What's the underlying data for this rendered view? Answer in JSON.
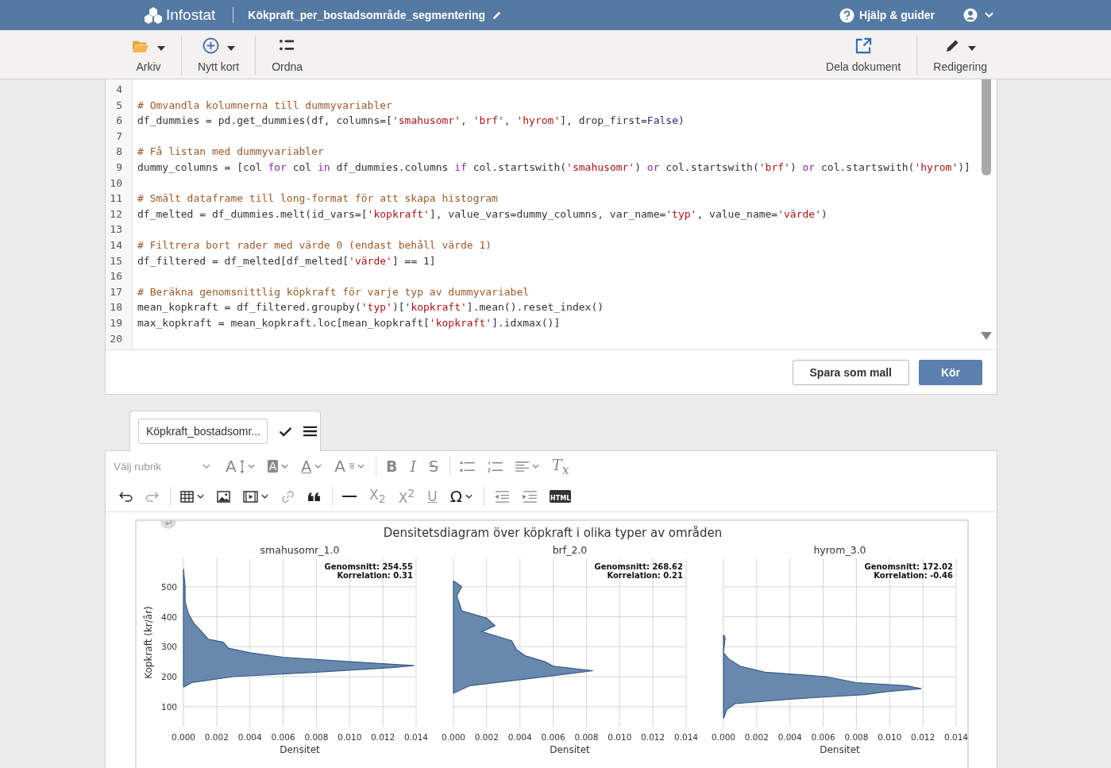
{
  "header": {
    "app_name": "Infostat",
    "document_title": "Kökpraft_per_bostadsområde_segmentering",
    "help": "Hjälp & guider"
  },
  "toolbar": {
    "left": [
      {
        "label": "Arkiv",
        "dropdown": true
      },
      {
        "label": "Nytt kort",
        "dropdown": true
      },
      {
        "label": "Ordna",
        "dropdown": false
      }
    ],
    "right": [
      {
        "label": "Dela dokument",
        "dropdown": false
      },
      {
        "label": "Redigering",
        "dropdown": true
      }
    ]
  },
  "code_editor": {
    "lines": [
      {
        "num": "4"
      },
      {
        "num": "5",
        "tokens": [
          {
            "kind": "comment",
            "text": "# Omvandla kolumnerna till dummyvariabler"
          }
        ]
      },
      {
        "num": "6",
        "tokens": [
          {
            "kind": "plain",
            "text": "df_dummies = pd.get_dummies(df, columns=["
          },
          {
            "kind": "string",
            "text": "'smahusomr'"
          },
          {
            "kind": "plain",
            "text": ", "
          },
          {
            "kind": "string",
            "text": "'brf'"
          },
          {
            "kind": "plain",
            "text": ", "
          },
          {
            "kind": "string",
            "text": "'hyrom'"
          },
          {
            "kind": "plain",
            "text": "], drop_first="
          },
          {
            "kind": "constant",
            "text": "False"
          },
          {
            "kind": "plain",
            "text": ")"
          }
        ]
      },
      {
        "num": "7"
      },
      {
        "num": "8",
        "tokens": [
          {
            "kind": "comment",
            "text": "# Få listan med dummyvariabler"
          }
        ]
      },
      {
        "num": "9",
        "tokens": [
          {
            "kind": "plain",
            "text": "dummy_columns = [col "
          },
          {
            "kind": "keyword",
            "text": "for"
          },
          {
            "kind": "plain",
            "text": " col "
          },
          {
            "kind": "keyword",
            "text": "in"
          },
          {
            "kind": "plain",
            "text": " df_dummies.columns "
          },
          {
            "kind": "keyword",
            "text": "if"
          },
          {
            "kind": "plain",
            "text": " col.startswith("
          },
          {
            "kind": "string",
            "text": "'smahusomr'"
          },
          {
            "kind": "plain",
            "text": ") "
          },
          {
            "kind": "keyword",
            "text": "or"
          },
          {
            "kind": "plain",
            "text": " col.startswith("
          },
          {
            "kind": "string",
            "text": "'brf'"
          },
          {
            "kind": "plain",
            "text": ") "
          },
          {
            "kind": "keyword",
            "text": "or"
          },
          {
            "kind": "plain",
            "text": " col.startswith("
          },
          {
            "kind": "string",
            "text": "'hyrom'"
          },
          {
            "kind": "plain",
            "text": ")]"
          }
        ]
      },
      {
        "num": "10"
      },
      {
        "num": "11",
        "tokens": [
          {
            "kind": "comment",
            "text": "# Smält dataframe till long-format för att skapa histogram"
          }
        ]
      },
      {
        "num": "12",
        "tokens": [
          {
            "kind": "plain",
            "text": "df_melted = df_dummies.melt(id_vars=["
          },
          {
            "kind": "string",
            "text": "'kopkraft'"
          },
          {
            "kind": "plain",
            "text": "], value_vars=dummy_columns, var_name="
          },
          {
            "kind": "string",
            "text": "'typ'"
          },
          {
            "kind": "plain",
            "text": ", value_name="
          },
          {
            "kind": "string",
            "text": "'värde'"
          },
          {
            "kind": "plain",
            "text": ")"
          }
        ]
      },
      {
        "num": "13"
      },
      {
        "num": "14",
        "tokens": [
          {
            "kind": "comment",
            "text": "# Filtrera bort rader med värde 0 (endast behåll värde 1)"
          }
        ]
      },
      {
        "num": "15",
        "tokens": [
          {
            "kind": "plain",
            "text": "df_filtered = df_melted[df_melted["
          },
          {
            "kind": "string",
            "text": "'värde'"
          },
          {
            "kind": "plain",
            "text": "] == 1]"
          }
        ]
      },
      {
        "num": "16"
      },
      {
        "num": "17",
        "tokens": [
          {
            "kind": "comment",
            "text": "# Beräkna genomsnittlig köpkraft för varje typ av dummyvariabel"
          }
        ]
      },
      {
        "num": "18",
        "tokens": [
          {
            "kind": "plain",
            "text": "mean_kopkraft = df_filtered.groupby("
          },
          {
            "kind": "string",
            "text": "'typ'"
          },
          {
            "kind": "plain",
            "text": ")["
          },
          {
            "kind": "string",
            "text": "'kopkraft'"
          },
          {
            "kind": "plain",
            "text": "].mean().reset_index()"
          }
        ]
      },
      {
        "num": "19",
        "tokens": [
          {
            "kind": "plain",
            "text": "max_kopkraft = mean_kopkraft.loc[mean_kopkraft["
          },
          {
            "kind": "string",
            "text": "'kopkraft'"
          },
          {
            "kind": "plain",
            "text": "].idxmax()]"
          }
        ]
      },
      {
        "num": "20"
      }
    ],
    "buttons": [
      {
        "label": "Spara som mall",
        "kind": "secondary"
      },
      {
        "label": "Kör",
        "kind": "primary"
      }
    ]
  },
  "card_tab": {
    "value": "Köpkraft_bostadsomr..."
  },
  "editor_toolbar": {
    "heading_placeholder": "Välj rubrik",
    "glyphs": {
      "font_size": "A",
      "highlight": "A",
      "font_color": "A",
      "line_height": "A",
      "bold": "B",
      "italic": "I",
      "strike": "S",
      "clear": "T$_{x}$",
      "subscript": "X$_{2}$",
      "superscript": "X$^{2}$",
      "underline": "U",
      "special": "Ω",
      "html": "HTML"
    }
  },
  "figure": {
    "title": "Densitetsdiagram över köpkraft i olika typer av områden",
    "panels": [
      {
        "chart_data": {
          "type": "area",
          "orientation": "horizontal",
          "title": "smahusomr_1.0",
          "xlabel": "Densitet",
          "ylabel": "Kopkraft (kr/år)",
          "x": [
            165,
            180,
            200,
            215,
            230,
            237,
            250,
            265,
            280,
            295,
            315,
            325,
            350,
            380,
            410,
            450,
            500,
            560
          ],
          "series": [
            {
              "color": "#6888ae",
              "values": [
                0,
                0.0005,
                0.003,
                0.008,
                0.0125,
                0.0139,
                0.01,
                0.006,
                0.004,
                0.0027,
                0.0024,
                0.0015,
                0.0011,
                0.0006,
                0.0003,
                0.0001,
                0.0001,
                0
              ]
            }
          ],
          "xlim": [
            0,
            0.014
          ],
          "ylim": [
            33,
            595
          ],
          "xticks": [
            {
              "value": 0,
              "label": "0.000"
            },
            {
              "value": 0.002,
              "label": "0.002"
            },
            {
              "value": 0.004,
              "label": "0.004"
            },
            {
              "value": 0.006,
              "label": "0.006"
            },
            {
              "value": 0.008,
              "label": "0.008"
            },
            {
              "value": 0.01,
              "label": "0.010"
            },
            {
              "value": 0.012,
              "label": "0.012"
            },
            {
              "value": 0.014,
              "label": "0.014"
            }
          ],
          "yticks": [
            100,
            200,
            300,
            400,
            500
          ],
          "grid": true,
          "annotations": [
            "Genomsnitt: 254.55",
            "Korrelation: 0.31"
          ]
        }
      },
      {
        "chart_data": {
          "type": "area",
          "orientation": "horizontal",
          "title": "brf_2.0",
          "xlabel": "Densitet",
          "x": [
            145,
            170,
            190,
            210,
            220,
            235,
            250,
            270,
            290,
            320,
            350,
            370,
            395,
            420,
            470,
            500,
            520
          ],
          "series": [
            {
              "color": "#6888ae",
              "values": [
                0,
                0.001,
                0.004,
                0.007,
                0.0084,
                0.006,
                0.0055,
                0.0043,
                0.0038,
                0.0035,
                0.0017,
                0.0025,
                0.002,
                0.0005,
                0.0002,
                0.0005,
                0
              ]
            }
          ],
          "xlim": [
            0,
            0.014
          ],
          "ylim": [
            33,
            595
          ],
          "xticks": [
            {
              "value": 0,
              "label": "0.000"
            },
            {
              "value": 0.002,
              "label": "0.002"
            },
            {
              "value": 0.004,
              "label": "0.004"
            },
            {
              "value": 0.006,
              "label": "0.006"
            },
            {
              "value": 0.008,
              "label": "0.008"
            },
            {
              "value": 0.01,
              "label": "0.010"
            },
            {
              "value": 0.012,
              "label": "0.012"
            },
            {
              "value": 0.014,
              "label": "0.014"
            }
          ],
          "grid": true,
          "annotations": [
            "Genomsnitt: 268.62",
            "Korrelation: 0.21"
          ]
        }
      },
      {
        "chart_data": {
          "type": "area",
          "orientation": "horizontal",
          "title": "hyrom_3.0",
          "xlabel": "Densitet",
          "x": [
            60,
            90,
            110,
            125,
            140,
            150,
            160,
            170,
            180,
            200,
            215,
            235,
            260,
            280,
            330,
            340
          ],
          "series": [
            {
              "color": "#6888ae",
              "values": [
                0,
                0.0002,
                0.0007,
                0.004,
                0.0085,
                0.0098,
                0.0119,
                0.011,
                0.008,
                0.0062,
                0.0025,
                0.001,
                0.0003,
                0,
                0.0001,
                0
              ]
            }
          ],
          "xlim": [
            0,
            0.014
          ],
          "ylim": [
            33,
            595
          ],
          "xticks": [
            {
              "value": 0,
              "label": "0.000"
            },
            {
              "value": 0.002,
              "label": "0.002"
            },
            {
              "value": 0.004,
              "label": "0.004"
            },
            {
              "value": 0.006,
              "label": "0.006"
            },
            {
              "value": 0.008,
              "label": "0.008"
            },
            {
              "value": 0.01,
              "label": "0.010"
            },
            {
              "value": 0.012,
              "label": "0.012"
            },
            {
              "value": 0.014,
              "label": "0.014"
            }
          ],
          "grid": true,
          "annotations": [
            "Genomsnitt: 172.02",
            "Korrelation: -0.46"
          ]
        }
      }
    ]
  }
}
